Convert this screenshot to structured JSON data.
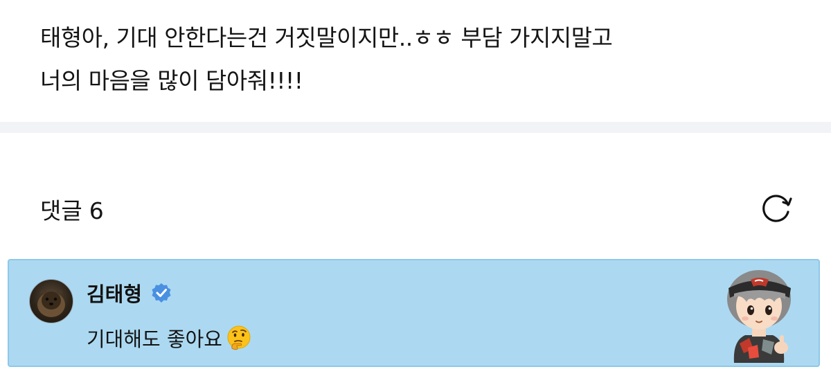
{
  "post": {
    "line1": "태형아, 기대 안한다는건 거짓말이지만..ㅎㅎ 부담 가지지말고",
    "line2": "너의 마음을 많이 담아줘!!!!"
  },
  "comments": {
    "label": "댓글",
    "count": "6",
    "refresh_icon": "refresh-icon"
  },
  "comment": {
    "author": "김태형",
    "verified_icon": "verified-badge-icon",
    "text": "기대해도 좋아요",
    "emoji": "thinking-face-emoji",
    "highlight_color": "#acd9f1",
    "verified_color": "#4a90e2"
  }
}
